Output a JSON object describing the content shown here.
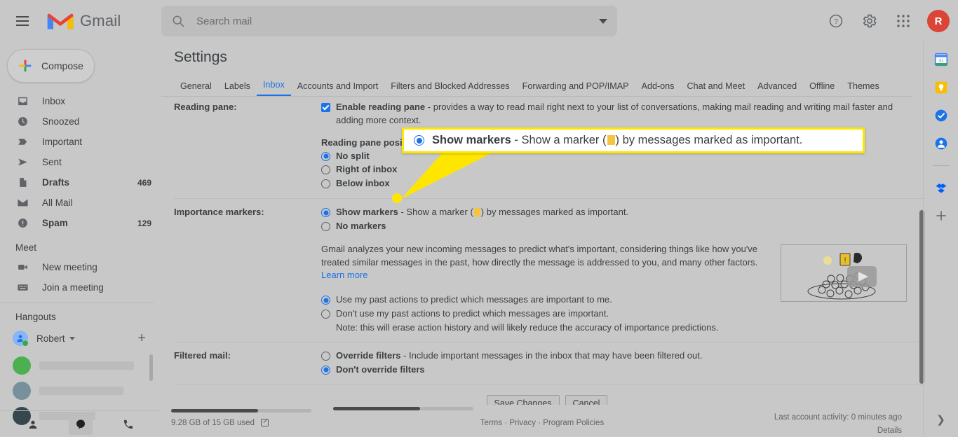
{
  "header": {
    "menu_icon": "hamburger-icon",
    "brand": "Gmail",
    "search_placeholder": "Search mail",
    "search_value": "",
    "help_icon": "help-icon",
    "settings_icon": "gear-icon",
    "apps_icon": "apps-grid-icon",
    "avatar_initial": "R"
  },
  "sidebar": {
    "compose_label": "Compose",
    "items": [
      {
        "label": "Inbox",
        "count": "",
        "icon": "inbox-icon",
        "bold": false
      },
      {
        "label": "Snoozed",
        "count": "",
        "icon": "clock-icon",
        "bold": false
      },
      {
        "label": "Important",
        "count": "",
        "icon": "important-marker-icon",
        "bold": false
      },
      {
        "label": "Sent",
        "count": "",
        "icon": "send-icon",
        "bold": false
      },
      {
        "label": "Drafts",
        "count": "469",
        "icon": "draft-icon",
        "bold": true
      },
      {
        "label": "All Mail",
        "count": "",
        "icon": "mail-icon",
        "bold": false
      },
      {
        "label": "Spam",
        "count": "129",
        "icon": "spam-icon",
        "bold": true
      }
    ],
    "meet_section": "Meet",
    "meet_items": [
      {
        "label": "New meeting",
        "icon": "video-camera-icon"
      },
      {
        "label": "Join a meeting",
        "icon": "keyboard-icon"
      }
    ],
    "hangouts_section": "Hangouts",
    "hangouts_user": "Robert",
    "add_contact_icon": "plus-icon",
    "footer_buttons": [
      "contacts-icon",
      "hangouts-icon",
      "phone-icon"
    ]
  },
  "main": {
    "page_title": "Settings",
    "tabs": [
      {
        "label": "General",
        "active": false
      },
      {
        "label": "Labels",
        "active": false
      },
      {
        "label": "Inbox",
        "active": true
      },
      {
        "label": "Accounts and Import",
        "active": false
      },
      {
        "label": "Filters and Blocked Addresses",
        "active": false
      },
      {
        "label": "Forwarding and POP/IMAP",
        "active": false
      },
      {
        "label": "Add-ons",
        "active": false
      },
      {
        "label": "Chat and Meet",
        "active": false
      },
      {
        "label": "Advanced",
        "active": false
      },
      {
        "label": "Offline",
        "active": false
      },
      {
        "label": "Themes",
        "active": false
      }
    ],
    "reading_pane": {
      "label": "Reading pane:",
      "enable_bold": "Enable reading pane",
      "enable_rest": " - provides a way to read mail right next to your list of conversations, making mail reading and writing mail faster and adding more context.",
      "enabled": true,
      "position_label": "Reading pane position",
      "options": [
        {
          "label": "No split",
          "selected": true
        },
        {
          "label": "Right of inbox",
          "selected": false
        },
        {
          "label": "Below inbox",
          "selected": false
        }
      ]
    },
    "importance_markers": {
      "label": "Importance markers:",
      "show_bold": "Show markers",
      "show_rest_a": " - Show a marker (",
      "show_rest_b": ") by messages marked as important.",
      "no_markers": "No markers",
      "selected": "Show markers",
      "description": "Gmail analyzes your new incoming messages to predict what's important, considering things like how you've treated similar messages in the past, how directly the message is addressed to you, and many other factors.",
      "learn_more": "Learn more",
      "prediction_options": [
        {
          "label": "Use my past actions to predict which messages are important to me.",
          "selected": true
        },
        {
          "label": "Don't use my past actions to predict which messages are important.",
          "selected": false
        }
      ],
      "note": "Note: this will erase action history and will likely reduce the accuracy of importance predictions.",
      "video_thumbnail": "importance-markers-video-thumbnail"
    },
    "filtered_mail": {
      "label": "Filtered mail:",
      "override_bold": "Override filters",
      "override_rest": " - Include important messages in the inbox that may have been filtered out.",
      "override_selected": false,
      "dont_override": "Don't override filters",
      "dont_override_selected": true
    },
    "save_label": "Save Changes",
    "cancel_label": "Cancel"
  },
  "callout": {
    "bold": "Show markers",
    "rest_a": " - Show a marker (",
    "rest_b": ") by messages marked as important.",
    "border_color": "#ffe600",
    "background": "#ffffff"
  },
  "footer": {
    "storage": "9.28 GB of 15 GB used",
    "storage_percent": 62,
    "links": [
      "Terms",
      "Privacy",
      "Program Policies"
    ],
    "separator": " · ",
    "activity": "Last account activity: 0 minutes ago",
    "details": "Details"
  },
  "rail": {
    "icons": [
      "calendar-icon",
      "keep-icon",
      "tasks-icon",
      "contacts-icon",
      "dropbox-icon",
      "add-addon-icon"
    ],
    "expand_icon": "chevron-right-icon"
  }
}
